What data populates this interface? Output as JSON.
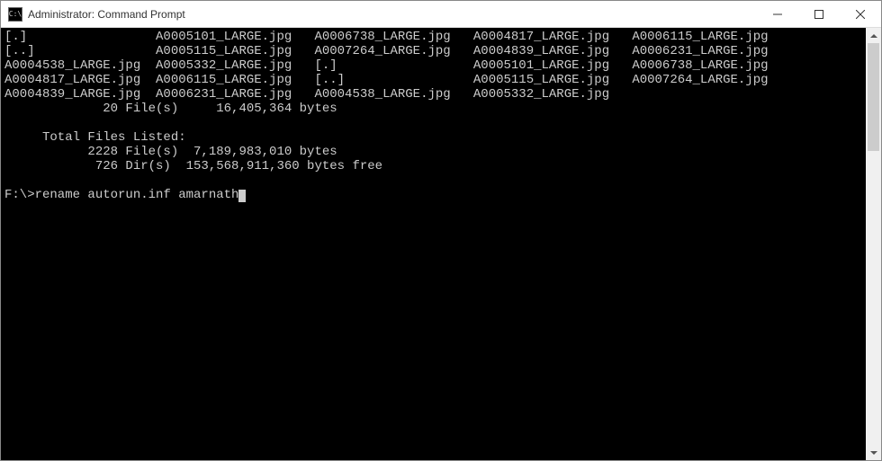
{
  "window": {
    "title": "Administrator: Command Prompt",
    "icon_text": "C:\\"
  },
  "terminal": {
    "lines": [
      "[.]                 A0005101_LARGE.jpg   A0006738_LARGE.jpg   A0004817_LARGE.jpg   A0006115_LARGE.jpg",
      "[..]                A0005115_LARGE.jpg   A0007264_LARGE.jpg   A0004839_LARGE.jpg   A0006231_LARGE.jpg",
      "A0004538_LARGE.jpg  A0005332_LARGE.jpg   [.]                  A0005101_LARGE.jpg   A0006738_LARGE.jpg",
      "A0004817_LARGE.jpg  A0006115_LARGE.jpg   [..]                 A0005115_LARGE.jpg   A0007264_LARGE.jpg",
      "A0004839_LARGE.jpg  A0006231_LARGE.jpg   A0004538_LARGE.jpg   A0005332_LARGE.jpg",
      "             20 File(s)     16,405,364 bytes",
      "",
      "     Total Files Listed:",
      "           2228 File(s)  7,189,983,010 bytes",
      "            726 Dir(s)  153,568,911,360 bytes free",
      "",
      "F:\\>rename autorun.inf amarnath"
    ],
    "prompt_prefix": "F:\\>",
    "current_command": "rename autorun.inf amarnath"
  },
  "summary": {
    "dir_files_count": 20,
    "dir_files_bytes": "16,405,364",
    "total_files_count": 2228,
    "total_files_bytes": "7,189,983,010",
    "total_dirs_count": 726,
    "bytes_free": "153,568,911,360"
  }
}
